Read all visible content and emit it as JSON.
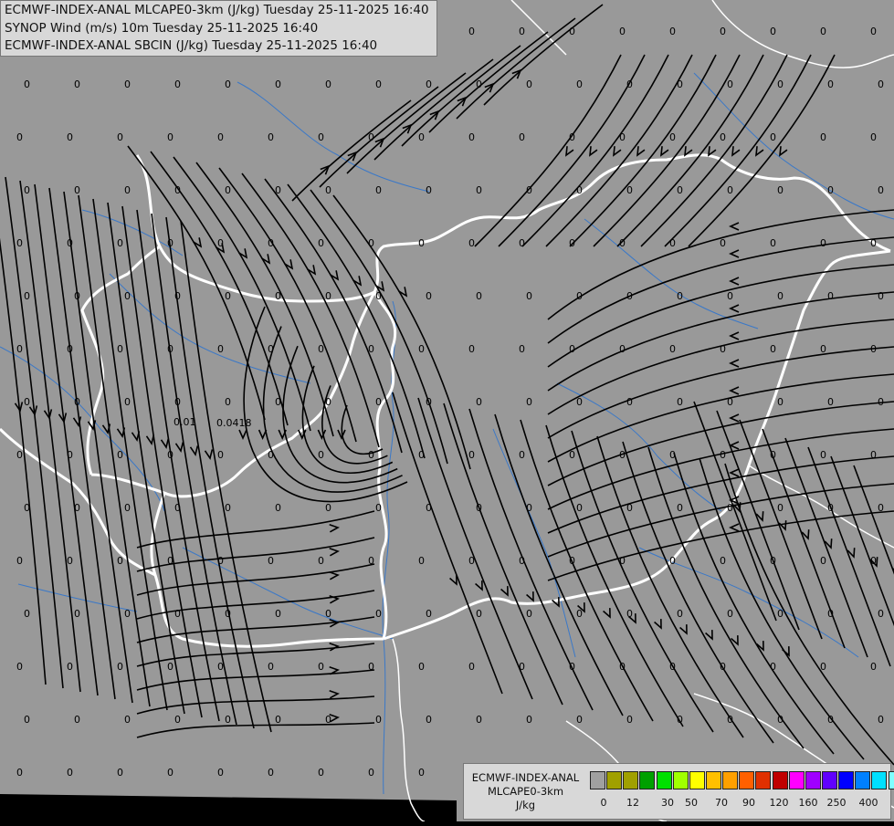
{
  "header": {
    "line1": "ECMWF-INDEX-ANAL MLCAPE0-3km (J/kg) Tuesday 25-11-2025 16:40",
    "line2": "SYNOP Wind (m/s) 10m Tuesday 25-11-2025 16:40",
    "line3": "ECMWF-INDEX-ANAL SBCIN (J/kg) Tuesday 25-11-2025 16:40"
  },
  "legend": {
    "line1": "ECMWF-INDEX-ANAL",
    "line2": "MLCAPE0-3km",
    "line3": "J/kg",
    "colors": [
      "#a0a0a0",
      "#a0a000",
      "#a0a000",
      "#00a000",
      "#00e000",
      "#a0ff00",
      "#ffff00",
      "#ffc000",
      "#ffa000",
      "#ff6000",
      "#e03000",
      "#c00000",
      "#ff00ff",
      "#a000ff",
      "#6000ff",
      "#0000ff",
      "#0080ff",
      "#00e0ff",
      "#80ffff",
      "#ffffff"
    ],
    "ticks": [
      "0",
      "12",
      "30",
      "50",
      "70",
      "90",
      "120",
      "160",
      "250",
      "400"
    ]
  },
  "map": {
    "background": "#999999",
    "border_color": "#ffffff",
    "river_color": "#3a78c8",
    "values": [
      "0",
      "0.01",
      "0.0418"
    ]
  }
}
